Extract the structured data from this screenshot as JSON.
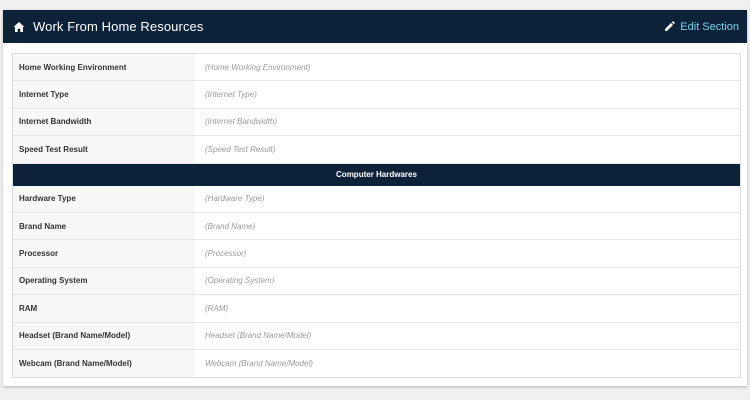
{
  "header": {
    "title": "Work From Home Resources",
    "edit_label": "Edit Section",
    "home_icon": "home-icon",
    "edit_icon": "pencil-icon"
  },
  "fields_group1": [
    {
      "label": "Home Working Environment",
      "value": "(Home Working Environment)"
    },
    {
      "label": "Internet Type",
      "value": "(Internet Type)"
    },
    {
      "label": "Internet Bandwidth",
      "value": "(Internet Bandwidth)"
    },
    {
      "label": "Speed Test Result",
      "value": "(Speed Test Result)"
    }
  ],
  "section_header": "Computer Hardwares",
  "fields_group2": [
    {
      "label": "Hardware Type",
      "value": "(Hardware Type)"
    },
    {
      "label": "Brand Name",
      "value": "(Brand Name)"
    },
    {
      "label": "Processor",
      "value": "(Processor)"
    },
    {
      "label": "Operating System",
      "value": "(Operating System)"
    },
    {
      "label": "RAM",
      "value": "(RAM)"
    },
    {
      "label": "Headset (Brand Name/Model)",
      "value": "Headset (Brand Name/Model)"
    },
    {
      "label": "Webcam (Brand Name/Model)",
      "value": "Webcam (Brand Name/Model)"
    }
  ],
  "colors": {
    "header_bg": "#0b2239",
    "edit_link": "#7fd3ea",
    "label_bg": "#f7f7f7",
    "placeholder_text": "#9a9a9a"
  }
}
